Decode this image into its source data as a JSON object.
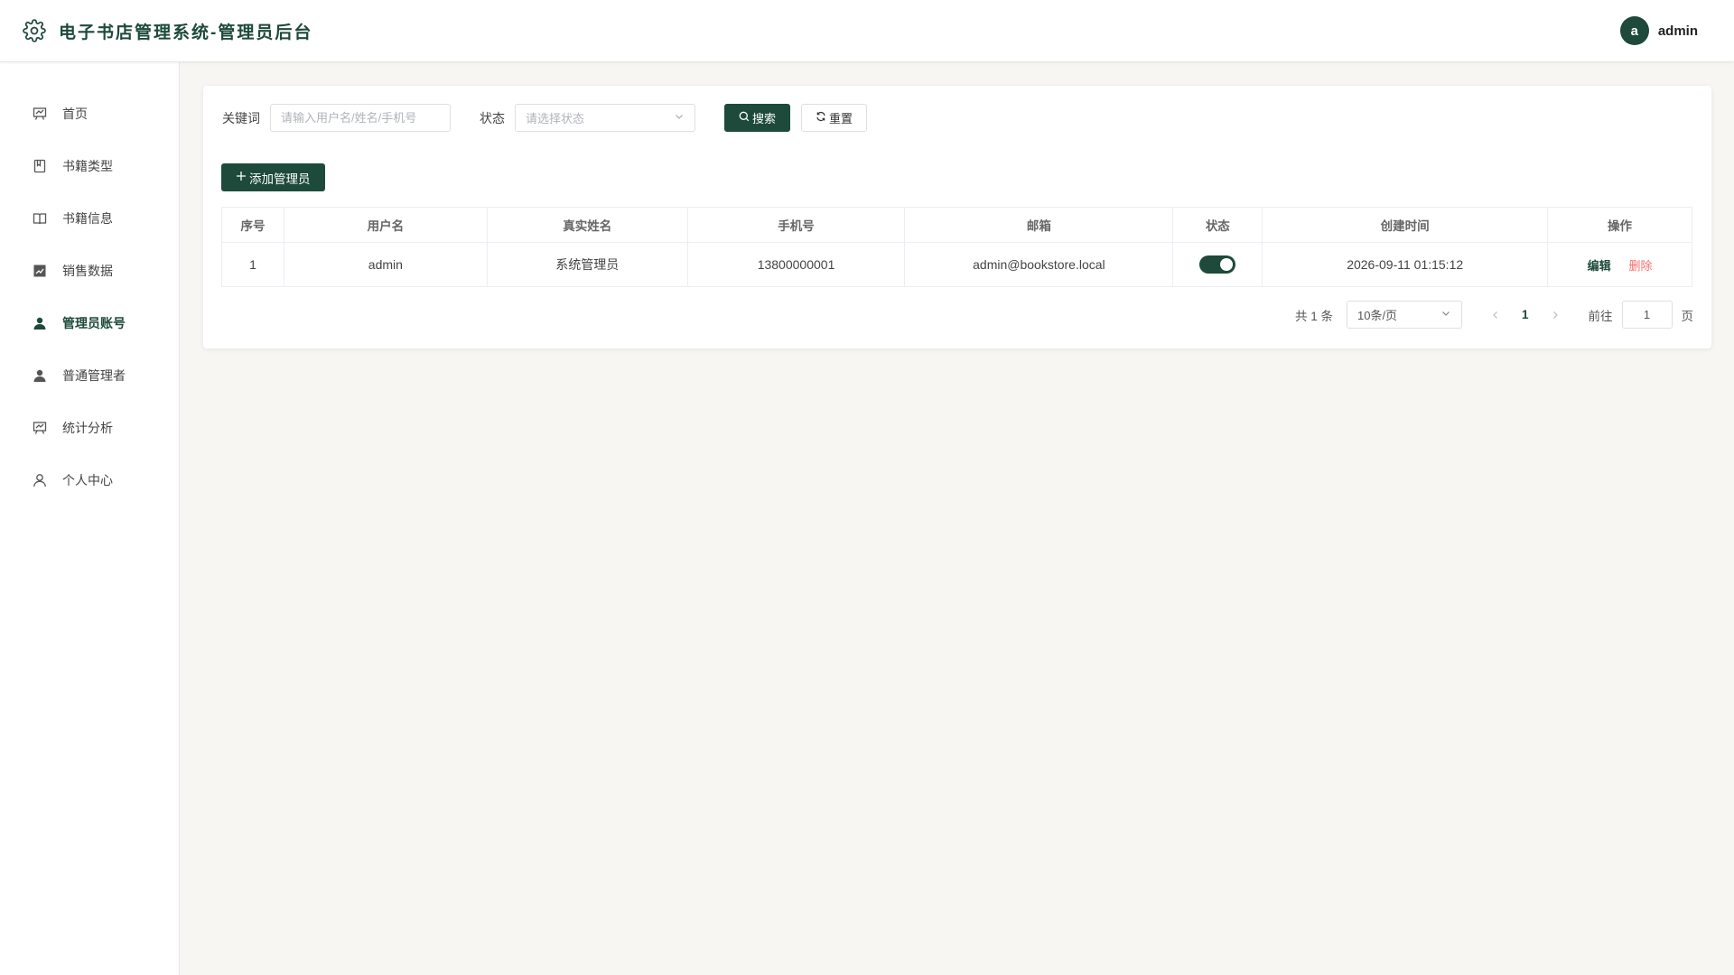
{
  "header": {
    "title": "电子书店管理系统-管理员后台",
    "avatar_letter": "a",
    "username": "admin"
  },
  "sidebar": {
    "items": [
      {
        "label": "首页",
        "icon": "presentation-icon",
        "active": false
      },
      {
        "label": "书籍类型",
        "icon": "book-icon",
        "active": false
      },
      {
        "label": "书籍信息",
        "icon": "open-book-icon",
        "active": false
      },
      {
        "label": "销售数据",
        "icon": "chart-icon",
        "active": false
      },
      {
        "label": "管理员账号",
        "icon": "user-filled-icon",
        "active": true
      },
      {
        "label": "普通管理者",
        "icon": "user-filled-icon",
        "active": false
      },
      {
        "label": "统计分析",
        "icon": "presentation-icon",
        "active": false
      },
      {
        "label": "个人中心",
        "icon": "user-outline-icon",
        "active": false
      }
    ]
  },
  "filters": {
    "keyword_label": "关键词",
    "keyword_placeholder": "请输入用户名/姓名/手机号",
    "status_label": "状态",
    "status_placeholder": "请选择状态",
    "search_label": "搜索",
    "reset_label": "重置"
  },
  "add_button_label": "添加管理员",
  "table": {
    "headers": [
      "序号",
      "用户名",
      "真实姓名",
      "手机号",
      "邮箱",
      "状态",
      "创建时间",
      "操作"
    ],
    "rows": [
      {
        "index": "1",
        "username": "admin",
        "real_name": "系统管理员",
        "phone": "13800000001",
        "email": "admin@bookstore.local",
        "status_enabled": true,
        "created_at": "2026-09-11 01:15:12",
        "edit_label": "编辑",
        "delete_label": "删除"
      }
    ]
  },
  "pagination": {
    "total_text": "共 1 条",
    "page_size": "10条/页",
    "current_page": "1",
    "goto_label": "前往",
    "goto_value": "1",
    "page_suffix": "页"
  },
  "colors": {
    "primary": "#1d4a3a",
    "danger": "#f56c6c",
    "background": "#f8f6f2"
  }
}
